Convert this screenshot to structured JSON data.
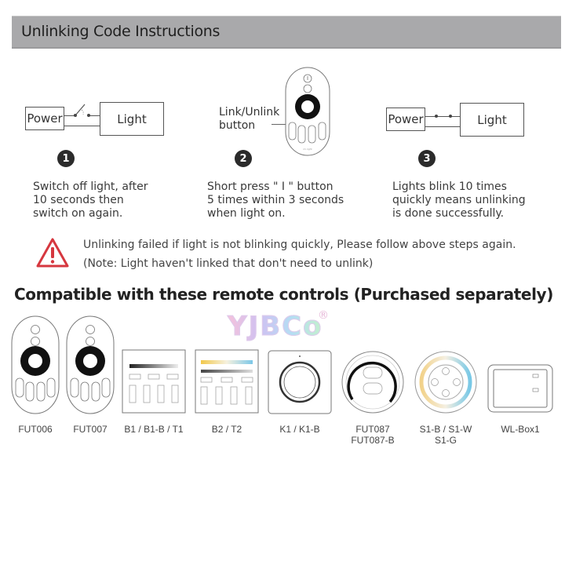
{
  "header": {
    "title": "Unlinking Code Instructions"
  },
  "steps": [
    {
      "number": "1",
      "diagram": {
        "left_box": "Power",
        "right_box": "Light",
        "switch": "open"
      },
      "text": "Switch off light, after\n10 seconds then\nswitch on again."
    },
    {
      "number": "2",
      "diagram": {
        "callout": "Link/Unlink\nbutton"
      },
      "text": "Short press \" I \" button\n5 times within 3 seconds\nwhen light on."
    },
    {
      "number": "3",
      "diagram": {
        "left_box": "Power",
        "right_box": "Light",
        "switch": "closed"
      },
      "text": "Lights blink 10 times\nquickly means unlinking\nis done successfully."
    }
  ],
  "warning": {
    "icon": "warning-triangle-icon",
    "color": "#d6373f",
    "line1": "Unlinking failed if light is not blinking quickly, Please follow above steps again.",
    "line2": "(Note: Light haven't linked that don't need to unlink)"
  },
  "compatible": {
    "title": "Compatible with these remote controls (Purchased separately)",
    "watermark": "YJBCo",
    "watermark_mark": "®",
    "products": [
      {
        "label": "FUT006"
      },
      {
        "label": "FUT007"
      },
      {
        "label": "B1 / B1-B / T1"
      },
      {
        "label": "B2 / T2"
      },
      {
        "label": "K1 / K1-B"
      },
      {
        "label": "FUT087\nFUT087-B"
      },
      {
        "label": "S1-B / S1-W\nS1-G"
      },
      {
        "label": "WL-Box1"
      }
    ]
  }
}
